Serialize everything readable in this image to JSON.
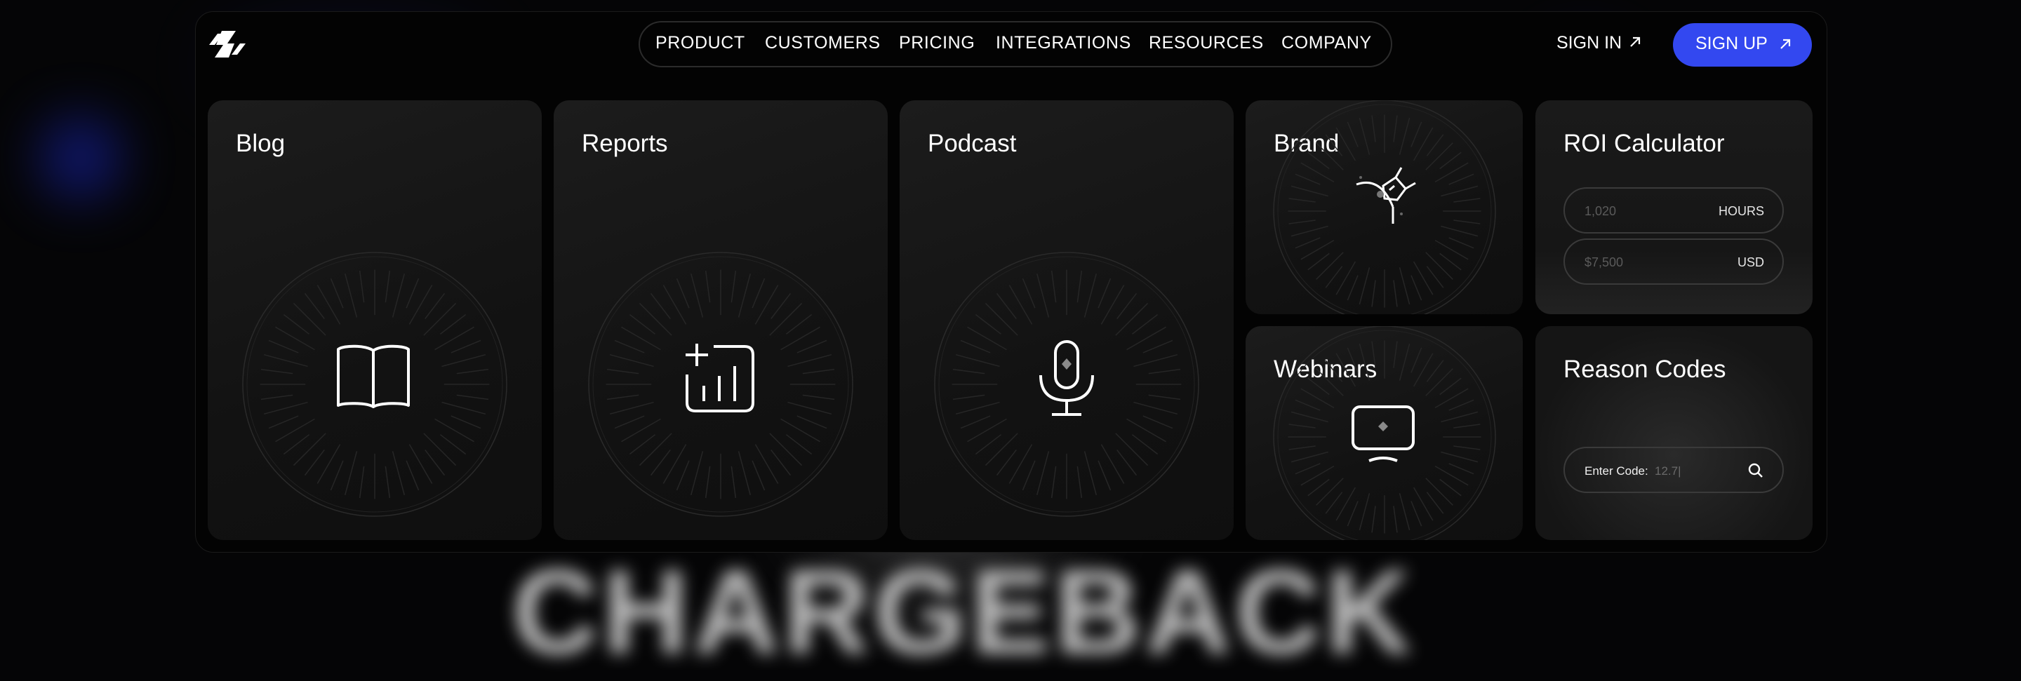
{
  "brand": {
    "logo_icon": "hoop-logo-icon",
    "accent": "#3348f0"
  },
  "nav": {
    "items": [
      "PRODUCT",
      "CUSTOMERS",
      "PRICING",
      "INTEGRATIONS",
      "RESOURCES",
      "COMPANY"
    ],
    "sign_in": "SIGN IN",
    "sign_up": "SIGN UP"
  },
  "cards": {
    "blog": {
      "title": "Blog",
      "icon": "book-icon"
    },
    "reports": {
      "title": "Reports",
      "icon": "bar-chart-plus-icon"
    },
    "podcast": {
      "title": "Podcast",
      "icon": "microphone-icon"
    },
    "brand": {
      "title": "Brand",
      "icon": "pen-tool-icon"
    },
    "webinars": {
      "title": "Webinars",
      "icon": "monitor-icon"
    },
    "roi": {
      "title": "ROI Calculator",
      "hours_value": "1,020",
      "hours_unit": "HOURS",
      "usd_value": "$7,500",
      "usd_unit": "USD"
    },
    "reason": {
      "title": "Reason Codes",
      "input_label": "Enter Code:",
      "input_value": "12.7|"
    }
  },
  "background_word": "CHARGEBACK"
}
